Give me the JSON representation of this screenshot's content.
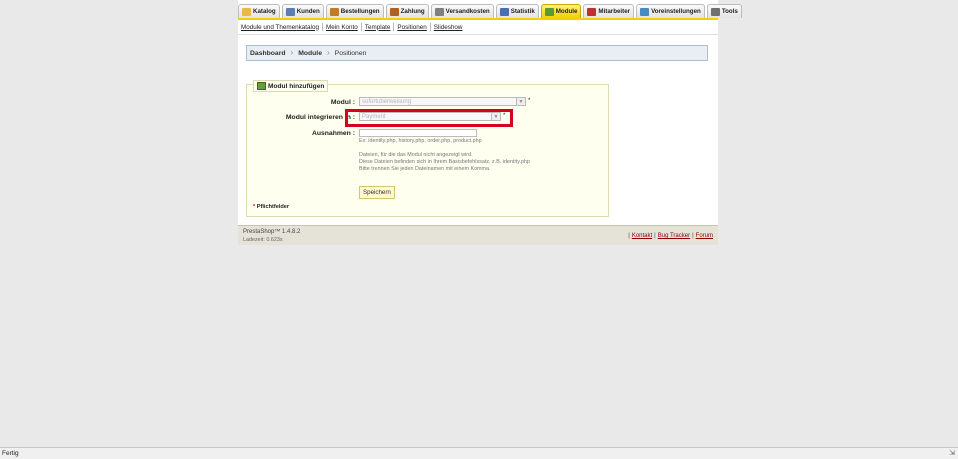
{
  "tabs": [
    {
      "label": "Katalog",
      "icon": "folder-icon",
      "color": "#e8b84a"
    },
    {
      "label": "Kunden",
      "icon": "user-icon",
      "color": "#5a7fb0"
    },
    {
      "label": "Bestellungen",
      "icon": "cart-icon",
      "color": "#c07a30"
    },
    {
      "label": "Zahlung",
      "icon": "money-icon",
      "color": "#b06020"
    },
    {
      "label": "Versandkosten",
      "icon": "truck-icon",
      "color": "#808080"
    },
    {
      "label": "Statistik",
      "icon": "chart-icon",
      "color": "#4a6fb0"
    },
    {
      "label": "Module",
      "icon": "puzzle-icon",
      "color": "#5a9a30",
      "active": true
    },
    {
      "label": "Mitarbeiter",
      "icon": "employee-icon",
      "color": "#c03030"
    },
    {
      "label": "Voreinstellungen",
      "icon": "monitor-icon",
      "color": "#4a8ac0"
    },
    {
      "label": "Tools",
      "icon": "wrench-icon",
      "color": "#707070"
    }
  ],
  "subnav": [
    "Module und Themenkatalog",
    "Mein Konto",
    "Template",
    "Positionen",
    "Slideshow"
  ],
  "breadcrumb": {
    "dashboard": "Dashboard",
    "module": "Module",
    "current": "Positionen"
  },
  "form": {
    "legend": "Modul hinzufügen",
    "modul_label": "Modul :",
    "modul_value": "sofortuberweisung",
    "hook_label": "Modul integrieren in :",
    "hook_value": "Payment",
    "required_star": "*",
    "exceptions_label": "Ausnahmen :",
    "exceptions_example": "Ex: identity.php, history.php, order.php, product.php",
    "help_line1": "Dateien, für die das Modul nicht angezeigt wird.",
    "help_line2": "Diese Dateien befinden sich in Ihrem Basisbefehlssatz, z.B. identity.php",
    "help_line3": "Bitte trennen Sie jeden Dateinamen mit einem Komma.",
    "save_label": "Speichern",
    "required_note": "Pflichtfelder"
  },
  "footer": {
    "version": "PrestaShop™ 1.4.8.2",
    "load_time": "Ladezeit: 0.623s",
    "links": [
      "Kontakt",
      "Bug Tracker",
      "Forum"
    ]
  },
  "statusbar": {
    "text": "Fertig"
  }
}
